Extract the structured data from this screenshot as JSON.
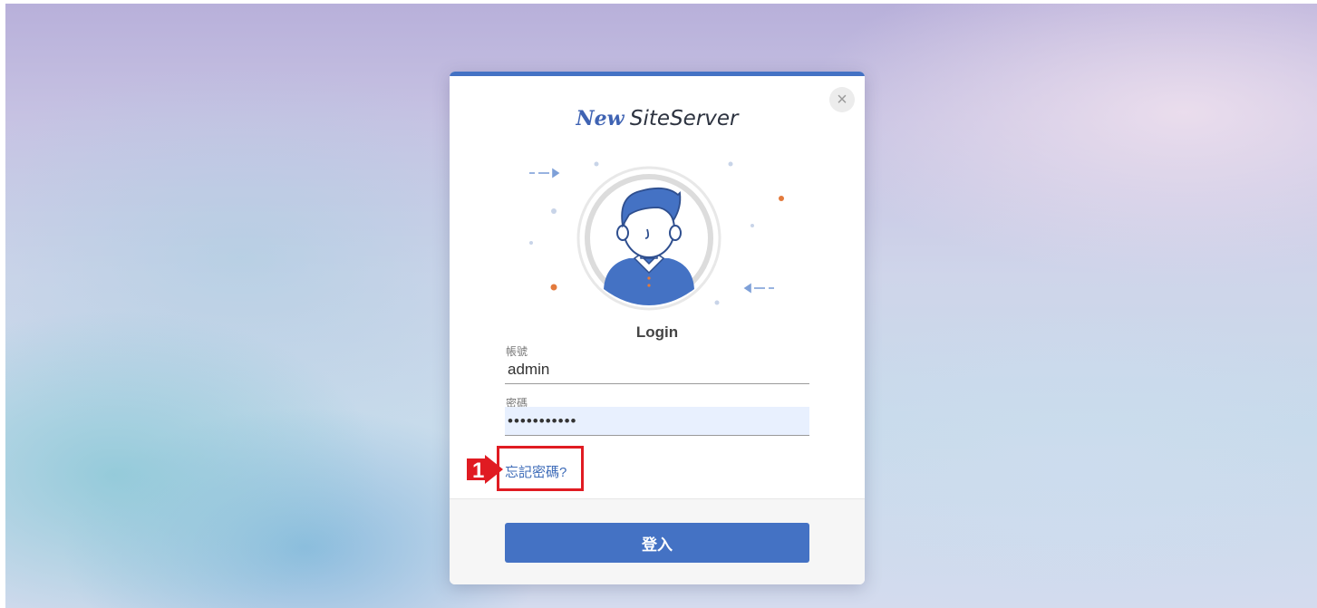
{
  "brand": {
    "new": "New",
    "name": "SiteServer"
  },
  "login": {
    "heading": "Login",
    "username_label": "帳號",
    "username_value": "admin",
    "password_label": "密碼",
    "password_value": "•••••••••••",
    "forgot_label": "忘記密碼?",
    "submit_label": "登入",
    "close_symbol": "×"
  },
  "annotation": {
    "number": "1",
    "color": "#e01b22"
  },
  "colors": {
    "accent": "#4472c4",
    "link": "#3d6bb8"
  },
  "icons": [
    "close-icon",
    "user-avatar-illustration",
    "arrow-right-icon",
    "arrow-left-icon"
  ]
}
